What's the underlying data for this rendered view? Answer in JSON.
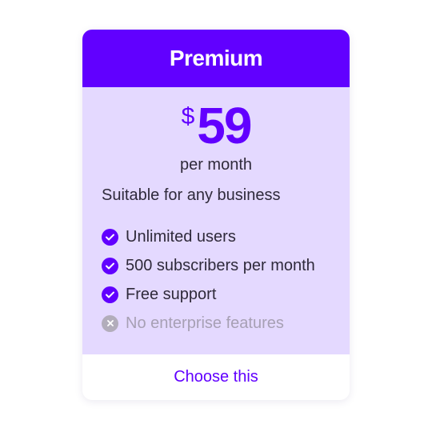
{
  "plan": {
    "name": "Premium",
    "currency": "$",
    "price": "59",
    "period": "per month",
    "tagline": "Suitable for any business"
  },
  "features": [
    {
      "label": "Unlimited users",
      "included": true,
      "icon": "check-circle-icon"
    },
    {
      "label": "500 subscribers per month",
      "included": true,
      "icon": "check-circle-icon"
    },
    {
      "label": "Free support",
      "included": true,
      "icon": "check-circle-icon"
    },
    {
      "label": "No enterprise features",
      "included": false,
      "icon": "x-circle-icon"
    }
  ],
  "cta": {
    "label": "Choose this"
  },
  "colors": {
    "accent": "#6100ff",
    "body_background": "#e4d9ff",
    "text": "#2f2a3a",
    "disabled_text": "#a7a0b4",
    "disabled_icon": "#b2adbb"
  }
}
